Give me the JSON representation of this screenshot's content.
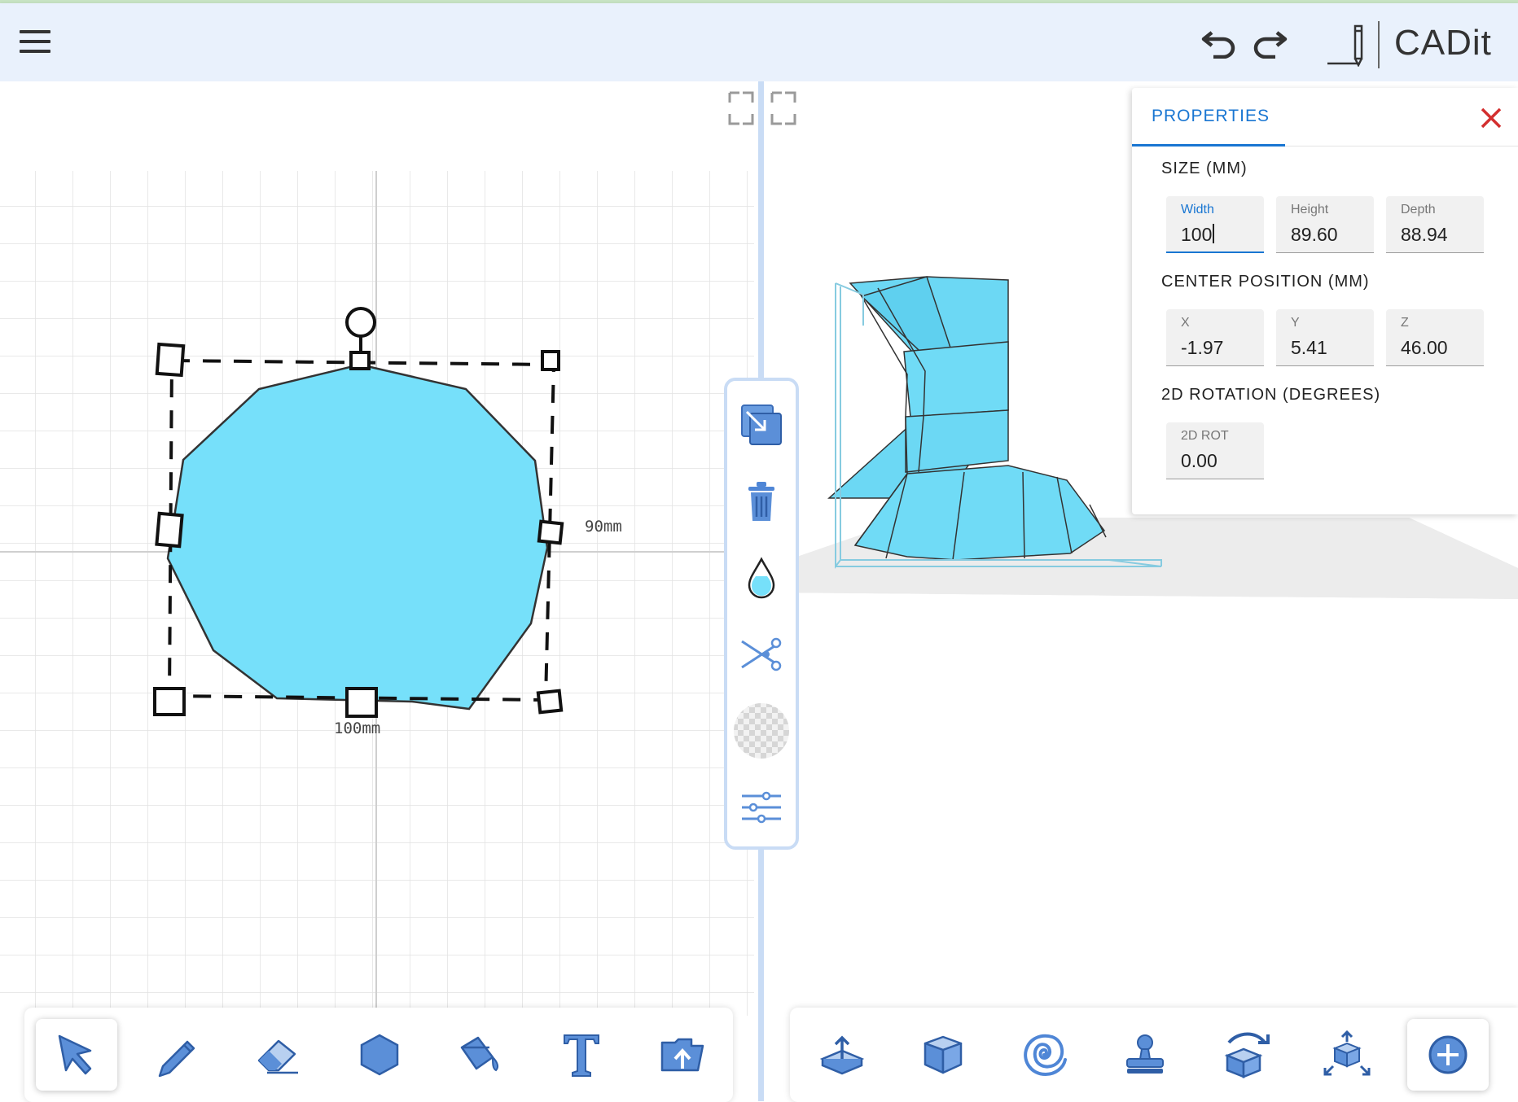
{
  "header": {
    "brand": "CADit",
    "menu_icon": "hamburger-menu-icon",
    "undo_icon": "undo-icon",
    "redo_icon": "redo-icon",
    "sketch_icon": "pencil-line-icon"
  },
  "canvas2d": {
    "width_label": "100mm",
    "height_label": "90mm",
    "shape_fill": "#76e0fa"
  },
  "view_controls": [
    "fullscreen-left-icon",
    "fullscreen-right-icon"
  ],
  "mid_toolbar": [
    "duplicate-icon",
    "trash-icon",
    "color-drop-icon",
    "scissors-icon",
    "transparency-icon",
    "sliders-icon"
  ],
  "bottom_left_tools": [
    "select-arrow-icon",
    "pencil-icon",
    "eraser-icon",
    "hexagon-icon",
    "paint-bucket-icon",
    "text-icon",
    "folder-upload-icon"
  ],
  "bottom_right_tools": [
    "extrude-icon",
    "box-icon",
    "spiral-icon",
    "stamp-icon",
    "rotate-cube-icon",
    "move-cube-icon",
    "add-circle-icon"
  ],
  "properties": {
    "tab": "PROPERTIES",
    "size": {
      "title": "SIZE (MM)",
      "width_label": "Width",
      "width": "100",
      "height_label": "Height",
      "height": "89.60",
      "depth_label": "Depth",
      "depth": "88.94"
    },
    "center": {
      "title": "CENTER POSITION (MM)",
      "x_label": "X",
      "x": "-1.97",
      "y_label": "Y",
      "y": "5.41",
      "z_label": "Z",
      "z": "46.00"
    },
    "rotation": {
      "title": "2D ROTATION (DEGREES)",
      "rot_label": "2D ROT",
      "rot": "0.00"
    }
  },
  "colors": {
    "accent": "#1976d2",
    "shape": "#76e0fa",
    "icon_blue": "#5b8fd8",
    "close": "#d32f2f"
  }
}
